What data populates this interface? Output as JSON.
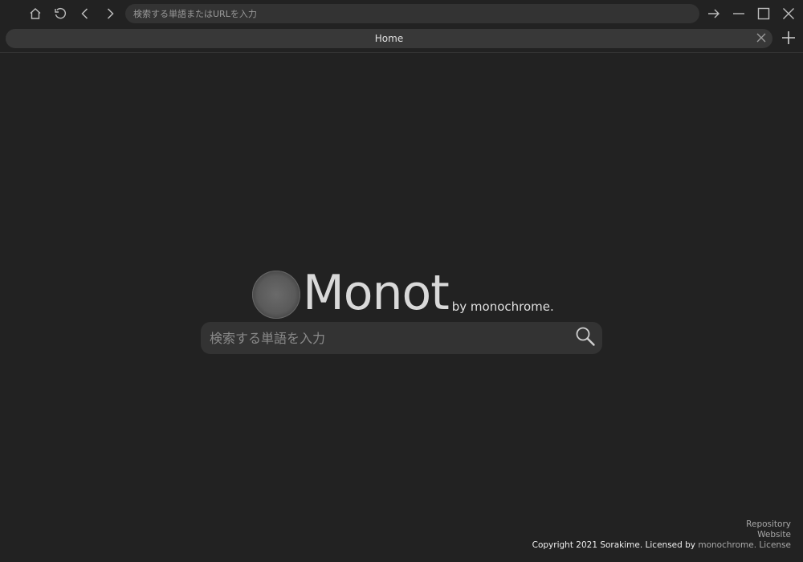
{
  "toolbar": {
    "address_placeholder": "検索する単語またはURLを入力",
    "icons": [
      "home-icon",
      "reload-icon",
      "back-icon",
      "forward-icon",
      "go-icon",
      "minimize-icon",
      "maximize-icon",
      "close-icon"
    ]
  },
  "tabs": [
    {
      "label": "Home"
    }
  ],
  "home": {
    "brand_name": "Monot",
    "brand_by": "by monochrome.",
    "search_placeholder": "検索する単語を入力"
  },
  "footer": {
    "repository": "Repository",
    "website": "Website",
    "copyright": "Copyright 2021 Sorakime. Licensed by",
    "licensor": "monochrome.",
    "license": "License"
  },
  "colors": {
    "background": "#222222",
    "field": "#333333",
    "tab": "#383838",
    "text": "#e8e8e8",
    "icon": "#bdbdbd"
  }
}
